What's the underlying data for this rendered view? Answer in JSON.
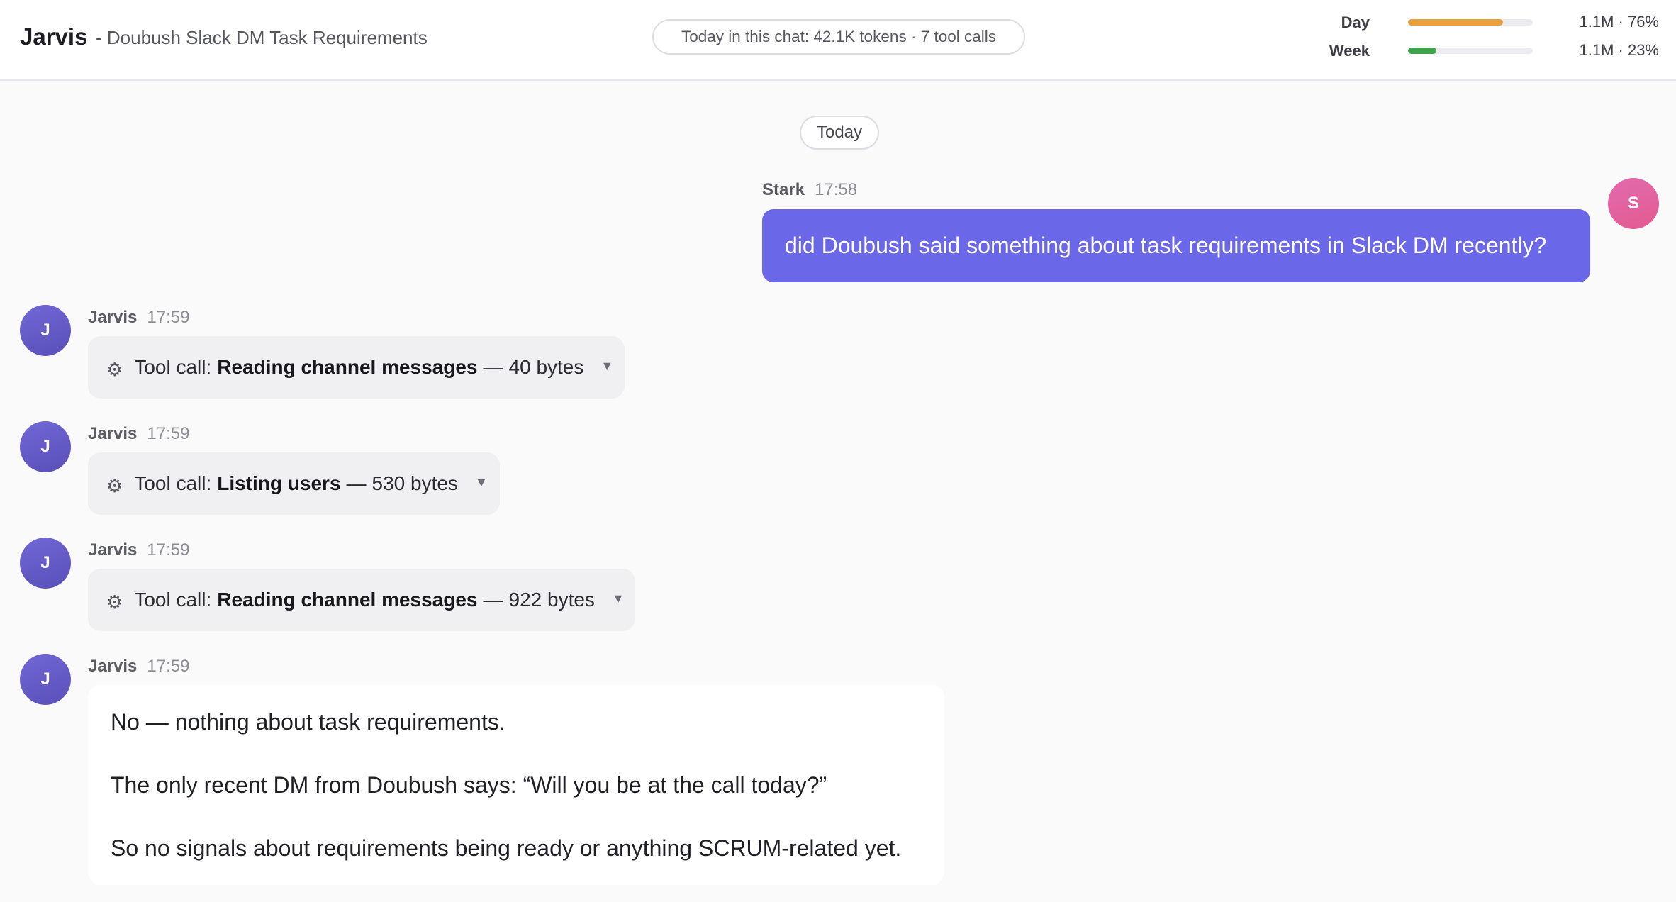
{
  "header": {
    "app_title": "Jarvis",
    "chat_title": "- Doubush Slack DM Task Requirements",
    "usage_summary": "Today in this chat: 42.1K tokens · 7 tool calls",
    "quotas": [
      {
        "label": "Day",
        "value_text": "1.1M · 76%",
        "percent": 76,
        "color": "#e9a23b"
      },
      {
        "label": "Week",
        "value_text": "1.1M · 23%",
        "percent": 23,
        "color": "#3fa34d"
      }
    ]
  },
  "date_divider": "Today",
  "messages": [
    {
      "role": "user",
      "author": "Stark",
      "time": "17:58",
      "avatar": "S",
      "text": "did Doubush said something about task requirements in Slack DM recently?"
    },
    {
      "role": "assistant",
      "author": "Jarvis",
      "time": "17:59",
      "avatar": "J",
      "tool": {
        "prefix": "Tool call:",
        "name": "Reading channel messages",
        "size": "40 bytes",
        "icon": "gear-icon"
      }
    },
    {
      "role": "assistant",
      "author": "Jarvis",
      "time": "17:59",
      "avatar": "J",
      "tool": {
        "prefix": "Tool call:",
        "name": "Listing users",
        "size": "530 bytes",
        "icon": "gear-icon"
      }
    },
    {
      "role": "assistant",
      "author": "Jarvis",
      "time": "17:59",
      "avatar": "J",
      "tool": {
        "prefix": "Tool call:",
        "name": "Reading channel messages",
        "size": "922 bytes",
        "icon": "gear-icon"
      }
    },
    {
      "role": "assistant",
      "author": "Jarvis",
      "time": "17:59",
      "avatar": "J",
      "paragraphs": [
        "No — nothing about task requirements.",
        "The only recent DM from Doubush says: “Will you be at the call today?”",
        "So no signals about requirements being ready or anything SCRUM-related yet."
      ]
    }
  ]
}
